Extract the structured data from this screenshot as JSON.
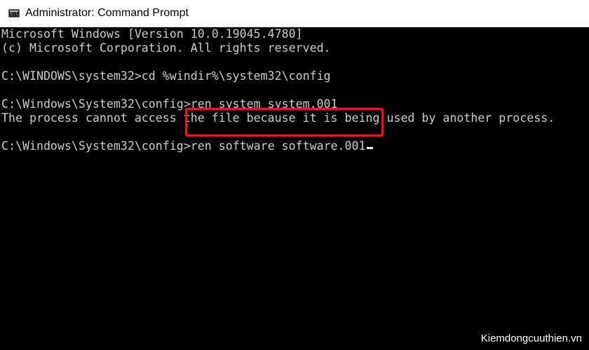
{
  "window": {
    "title": "Administrator: Command Prompt",
    "icon": "cmd-icon",
    "icon_text": "C:\\"
  },
  "console": {
    "lines": [
      "Microsoft Windows [Version 10.0.19045.4780]",
      "(c) Microsoft Corporation. All rights reserved.",
      "",
      "C:\\WINDOWS\\system32>cd %windir%\\system32\\config",
      "",
      "C:\\Windows\\System32\\config>ren system system.001",
      "The process cannot access the file because it is being used by another process.",
      "",
      "C:\\Windows\\System32\\config>"
    ],
    "current_input": "ren software software.001",
    "text_color": "#cccccc",
    "background": "#000000"
  },
  "highlight": {
    "color": "#e0192a"
  },
  "watermark": "Kiemdongcuuthien.vn"
}
